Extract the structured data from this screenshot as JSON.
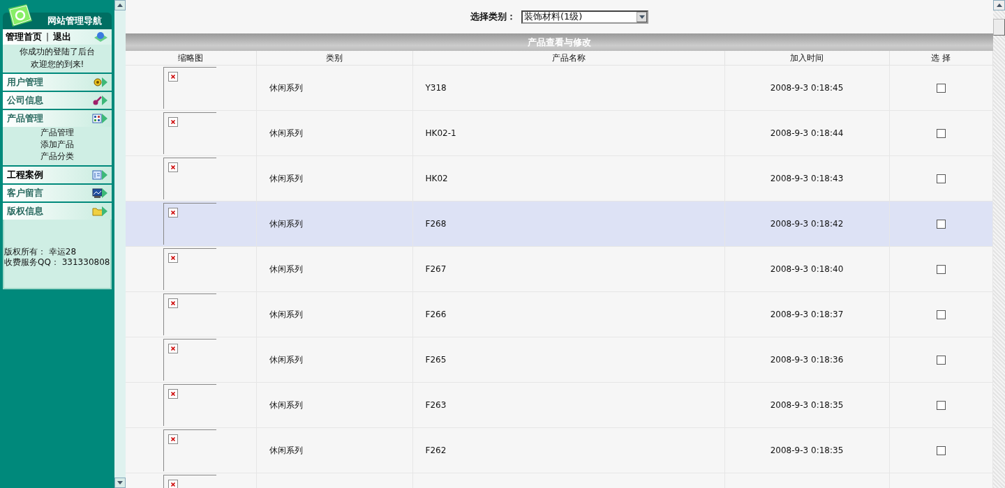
{
  "sidebar": {
    "title": "网站管理导航",
    "home_link": "管理首页",
    "separator": "|",
    "logout_link": "退出",
    "welcome_lines": [
      "你成功的登陆了后台",
      "欢迎您的到来!"
    ],
    "items": [
      {
        "label": "用户管理",
        "kind": "gear",
        "selected": false
      },
      {
        "label": "公司信息",
        "kind": "key",
        "selected": false
      },
      {
        "label": "产品管理",
        "kind": "grid",
        "selected": false,
        "expanded": true,
        "children": [
          {
            "label": "产品管理"
          },
          {
            "label": "添加产品"
          },
          {
            "label": "产品分类"
          }
        ]
      },
      {
        "label": "工程案例",
        "kind": "list",
        "selected": true
      },
      {
        "label": "客户留言",
        "kind": "screen",
        "selected": false
      },
      {
        "label": "版权信息",
        "kind": "folder",
        "selected": false,
        "expanded": true,
        "info": [
          "版权所有： 幸运28",
          "收费服务QQ： 331330808"
        ]
      }
    ]
  },
  "filter": {
    "label": "选择类别：",
    "value": "装饰材料(1级)"
  },
  "table": {
    "title": "产品查看与修改",
    "columns": [
      "缩略图",
      "类别",
      "产品名称",
      "加入时间",
      "选 择"
    ],
    "rows": [
      {
        "category": "休闲系列",
        "name": "Y318",
        "time": "2008-9-3 0:18:45",
        "checked": false,
        "highlighted": false
      },
      {
        "category": "休闲系列",
        "name": "HK02-1",
        "time": "2008-9-3 0:18:44",
        "checked": false,
        "highlighted": false
      },
      {
        "category": "休闲系列",
        "name": "HK02",
        "time": "2008-9-3 0:18:43",
        "checked": false,
        "highlighted": false
      },
      {
        "category": "休闲系列",
        "name": "F268",
        "time": "2008-9-3 0:18:42",
        "checked": false,
        "highlighted": true
      },
      {
        "category": "休闲系列",
        "name": "F267",
        "time": "2008-9-3 0:18:40",
        "checked": false,
        "highlighted": false
      },
      {
        "category": "休闲系列",
        "name": "F266",
        "time": "2008-9-3 0:18:37",
        "checked": false,
        "highlighted": false
      },
      {
        "category": "休闲系列",
        "name": "F265",
        "time": "2008-9-3 0:18:36",
        "checked": false,
        "highlighted": false
      },
      {
        "category": "休闲系列",
        "name": "F263",
        "time": "2008-9-3 0:18:35",
        "checked": false,
        "highlighted": false
      },
      {
        "category": "休闲系列",
        "name": "F262",
        "time": "2008-9-3 0:18:35",
        "checked": false,
        "highlighted": false
      },
      {
        "highlighted": false
      }
    ]
  }
}
